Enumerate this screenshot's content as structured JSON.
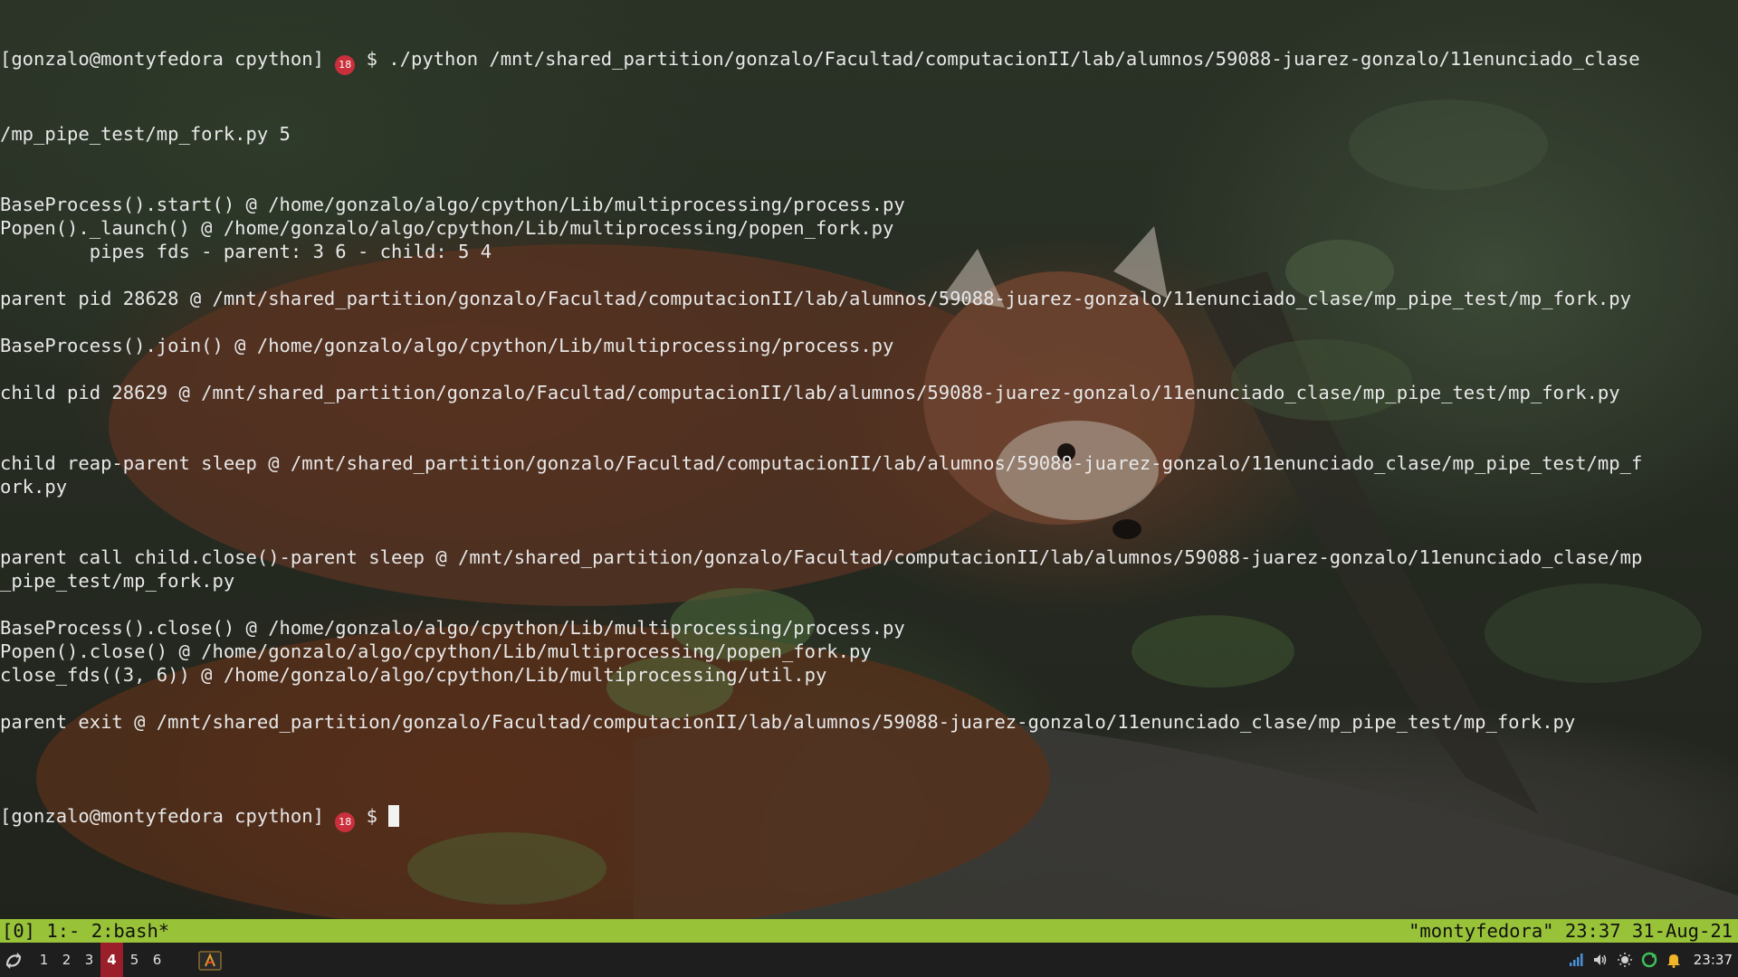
{
  "terminal": {
    "prompt_prefix": "[gonzalo@montyfedora cpython]",
    "prompt_badge": "18",
    "prompt_symbol": "$",
    "command_part1": "./python /mnt/shared_partition/gonzalo/Facultad/computacionII/lab/alumnos/59088-juarez-gonzalo/11enunciado_clase",
    "command_part2": "/mp_pipe_test/mp_fork.py 5",
    "output_lines": [
      "BaseProcess().start() @ /home/gonzalo/algo/cpython/Lib/multiprocessing/process.py",
      "Popen()._launch() @ /home/gonzalo/algo/cpython/Lib/multiprocessing/popen_fork.py",
      "\tpipes fds - parent: 3 6 - child: 5 4",
      "",
      "parent pid 28628 @ /mnt/shared_partition/gonzalo/Facultad/computacionII/lab/alumnos/59088-juarez-gonzalo/11enunciado_clase/mp_pipe_test/mp_fork.py",
      "",
      "BaseProcess().join() @ /home/gonzalo/algo/cpython/Lib/multiprocessing/process.py",
      "",
      "child pid 28629 @ /mnt/shared_partition/gonzalo/Facultad/computacionII/lab/alumnos/59088-juarez-gonzalo/11enunciado_clase/mp_pipe_test/mp_fork.py",
      "",
      "",
      "child reap-parent sleep @ /mnt/shared_partition/gonzalo/Facultad/computacionII/lab/alumnos/59088-juarez-gonzalo/11enunciado_clase/mp_pipe_test/mp_f",
      "ork.py",
      "",
      "",
      "parent call child.close()-parent sleep @ /mnt/shared_partition/gonzalo/Facultad/computacionII/lab/alumnos/59088-juarez-gonzalo/11enunciado_clase/mp",
      "_pipe_test/mp_fork.py",
      "",
      "BaseProcess().close() @ /home/gonzalo/algo/cpython/Lib/multiprocessing/process.py",
      "Popen().close() @ /home/gonzalo/algo/cpython/Lib/multiprocessing/popen_fork.py",
      "close_fds((3, 6)) @ /home/gonzalo/algo/cpython/Lib/multiprocessing/util.py",
      "",
      "parent exit @ /mnt/shared_partition/gonzalo/Facultad/computacionII/lab/alumnos/59088-juarez-gonzalo/11enunciado_clase/mp_pipe_test/mp_fork.py",
      ""
    ]
  },
  "tmux": {
    "left": "[0] 1:- 2:bash*",
    "right": "\"montyfedora\" 23:37 31-Aug-21"
  },
  "taskbar": {
    "workspaces": [
      "1",
      "2",
      "3",
      "4",
      "5",
      "6"
    ],
    "active_workspace": "4",
    "clock": "23:37",
    "tray_icons": [
      "network-signal-icon",
      "volume-icon",
      "brightness-icon",
      "update-icon",
      "notification-bell-icon"
    ]
  },
  "colors": {
    "tmux_status_bg": "#98c338",
    "active_workspace_bg": "#9a1f2b",
    "prompt_badge_bg": "#c9303b",
    "taskbar_bg": "#1e1e1e"
  }
}
